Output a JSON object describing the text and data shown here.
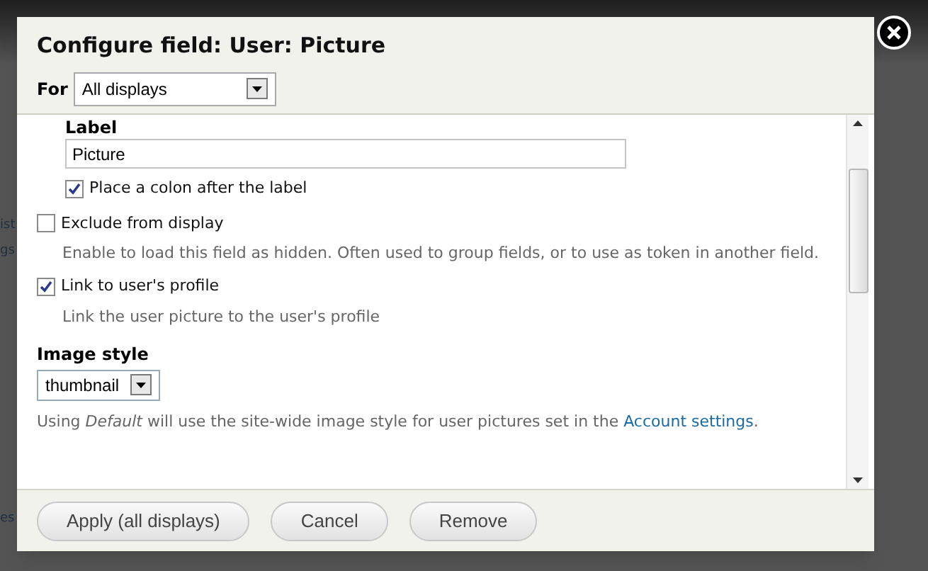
{
  "background_fragments": [
    "ist",
    "gs",
    "es"
  ],
  "dialog": {
    "title": "Configure field: User: Picture",
    "for": {
      "label": "For",
      "value": "All displays"
    },
    "label_field": {
      "label": "Label",
      "value": "Picture"
    },
    "options": [
      {
        "label": "Place a colon after the label",
        "checked": true,
        "indented": true
      },
      {
        "label": "Exclude from display",
        "checked": false,
        "indented": false,
        "description": "Enable to load this field as hidden. Often used to group fields, or to use as token in another field."
      },
      {
        "label": "Link to user's profile",
        "checked": true,
        "indented": false,
        "description": "Link the user picture to the user's profile"
      }
    ],
    "image_style": {
      "label": "Image style",
      "value": "thumbnail",
      "help": "Using *Default* will use the site-wide image style for user pictures set in the",
      "link": "Account settings",
      "after_link": "."
    },
    "buttons": [
      "Apply (all displays)",
      "Cancel",
      "Remove"
    ]
  }
}
